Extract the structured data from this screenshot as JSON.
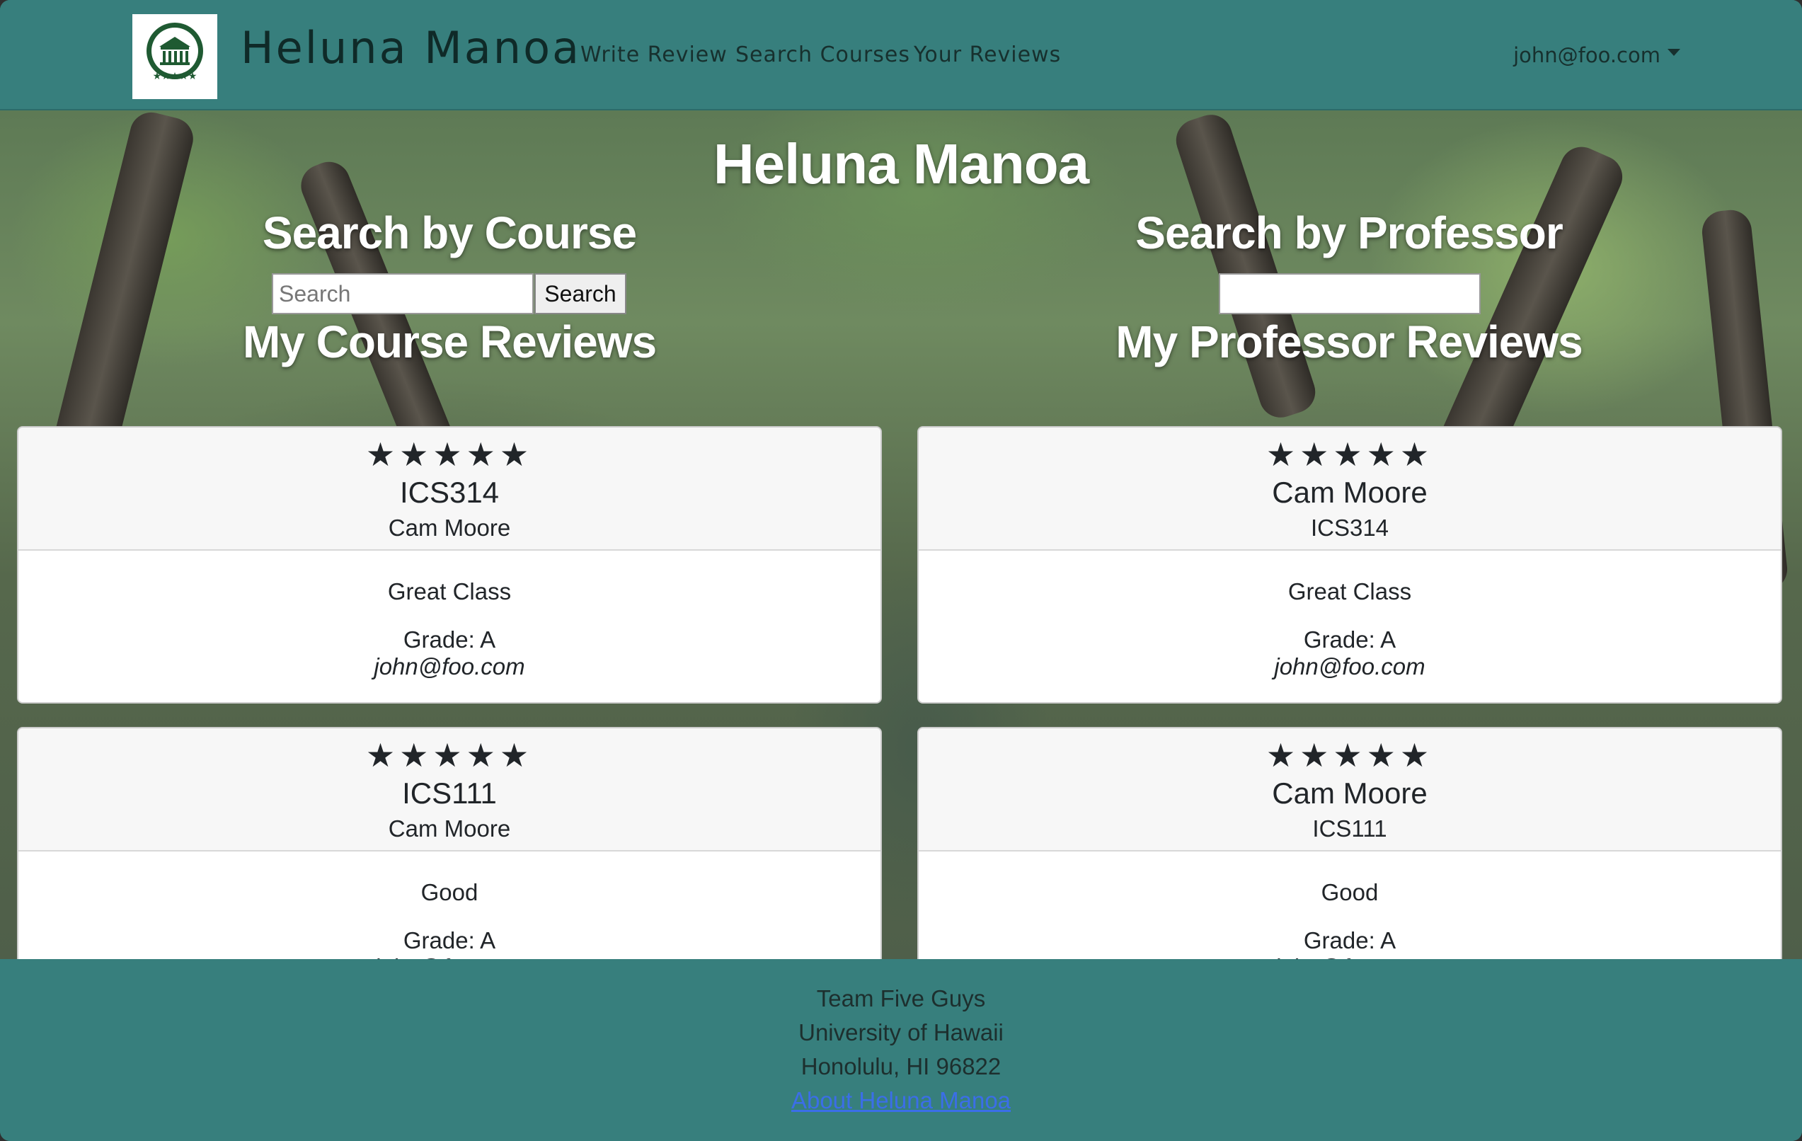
{
  "navbar": {
    "brand": "Heluna Manoa",
    "links": [
      "Write Review",
      "Search Courses",
      "Your Reviews"
    ],
    "user_email": "john@foo.com"
  },
  "hero": {
    "title": "Heluna Manoa",
    "course_search_title": "Search by Course",
    "course_search_placeholder": "Search",
    "course_search_button": "Search",
    "professor_search_title": "Search by Professor",
    "professor_search_value": "",
    "course_reviews_title": "My Course Reviews",
    "professor_reviews_title": "My Professor Reviews"
  },
  "course_reviews": [
    {
      "stars": "★★★★★",
      "rating": 5,
      "course": "ICS314",
      "professor": "Cam Moore",
      "comment": "Great Class",
      "grade": "Grade: A",
      "email": "john@foo.com"
    },
    {
      "stars": "★★★★★",
      "rating": 5,
      "course": "ICS111",
      "professor": "Cam Moore",
      "comment": "Good",
      "grade": "Grade: A",
      "email": "john@foo.com"
    }
  ],
  "professor_reviews": [
    {
      "stars": "★★★★★",
      "rating": 5,
      "professor": "Cam Moore",
      "course": "ICS314",
      "comment": "Great Class",
      "grade": "Grade: A",
      "email": "john@foo.com"
    },
    {
      "stars": "★★★★★",
      "rating": 5,
      "professor": "Cam Moore",
      "course": "ICS111",
      "comment": "Good",
      "grade": "Grade: A",
      "email": "john@foo.com"
    }
  ],
  "footer": {
    "line1": "Team Five Guys",
    "line2": "University of Hawaii",
    "line3": "Honolulu, HI 96822",
    "link": "About Heluna Manoa"
  },
  "colors": {
    "navbar_bg": "#377f7d",
    "footer_bg": "#377f7d",
    "link": "#3b6ee8"
  }
}
